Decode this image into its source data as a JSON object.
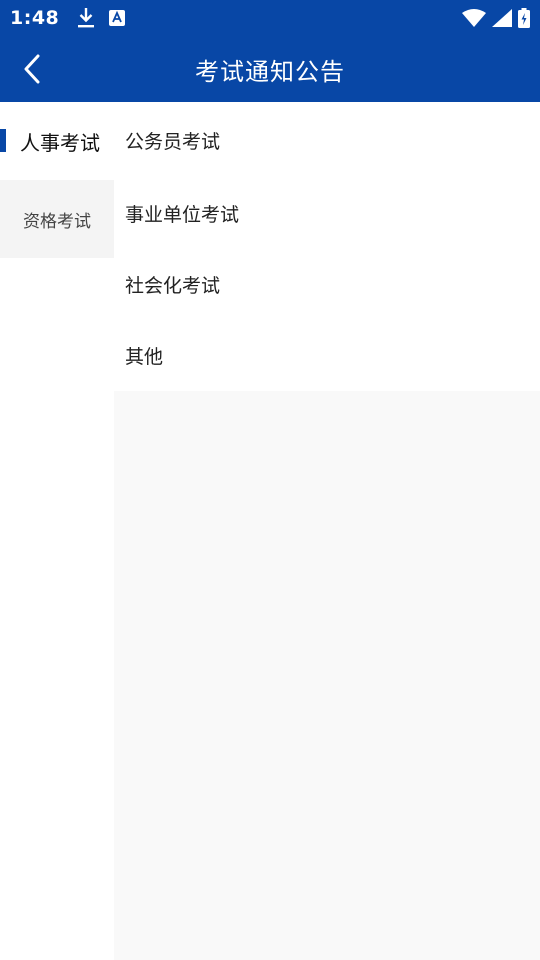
{
  "status_bar": {
    "time": "1:48",
    "left_icons": [
      "download-icon",
      "font-app-icon"
    ],
    "right_icons": [
      "wifi-icon",
      "signal-icon",
      "battery-charging-icon"
    ]
  },
  "header": {
    "title": "考试通知公告",
    "back_icon": "chevron-left-icon"
  },
  "sidebar": {
    "items": [
      {
        "label": "人事考试",
        "active": true
      },
      {
        "label": "资格考试",
        "active": false
      }
    ]
  },
  "list": {
    "items": [
      {
        "label": "公务员考试"
      },
      {
        "label": "事业单位考试"
      },
      {
        "label": "社会化考试"
      },
      {
        "label": "其他"
      }
    ]
  },
  "colors": {
    "primary": "#0847a6",
    "sidebar_inactive_bg": "#f4f4f4",
    "content_bg": "#f9f9f9"
  }
}
